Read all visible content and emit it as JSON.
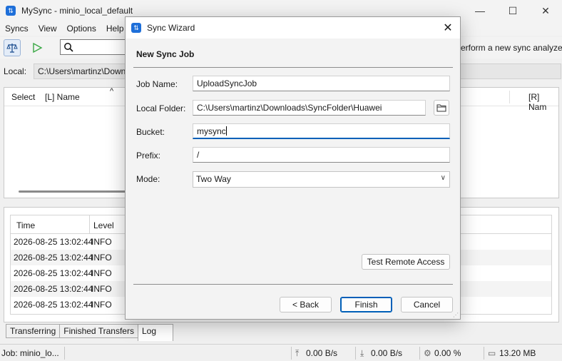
{
  "window": {
    "title": "MySync - minio_local_default"
  },
  "menu": [
    "Syncs",
    "View",
    "Options",
    "Help"
  ],
  "toolbar": {
    "right_text": "erform a new sync analyze"
  },
  "local": {
    "label": "Local:",
    "path": "C:\\Users\\martinz\\Down"
  },
  "files": {
    "headers": [
      "Select",
      "[L] Name",
      "[R] Nam"
    ]
  },
  "log": {
    "headers": [
      "Time",
      "Level"
    ],
    "rows": [
      {
        "time": "2026-08-25 13:02:44",
        "level": "INFO"
      },
      {
        "time": "2026-08-25 13:02:44",
        "level": "INFO"
      },
      {
        "time": "2026-08-25 13:02:44",
        "level": "INFO"
      },
      {
        "time": "2026-08-25 13:02:44",
        "level": "INFO"
      },
      {
        "time": "2026-08-25 13:02:44",
        "level": "INFO"
      }
    ]
  },
  "tabs": [
    "Transferring",
    "Finished Transfers",
    "Log"
  ],
  "status": {
    "job": "Job: minio_lo...",
    "up": "0.00 B/s",
    "down": "0.00 B/s",
    "cpu": "0.00 %",
    "mem": "13.20 MB"
  },
  "dialog": {
    "title": "Sync Wizard",
    "heading": "New Sync Job",
    "labels": {
      "job_name": "Job Name:",
      "local_folder": "Local Folder:",
      "bucket": "Bucket:",
      "prefix": "Prefix:",
      "mode": "Mode:"
    },
    "values": {
      "job_name": "UploadSyncJob",
      "local_folder": "C:\\Users\\martinz\\Downloads\\SyncFolder\\Huawei",
      "bucket": "mysync",
      "prefix": "/",
      "mode": "Two Way"
    },
    "buttons": {
      "test": "Test Remote Access",
      "back": "< Back",
      "finish": "Finish",
      "cancel": "Cancel"
    }
  },
  "colors": {
    "accent": "#005fb8",
    "app_icon": "#1e6fd9"
  }
}
